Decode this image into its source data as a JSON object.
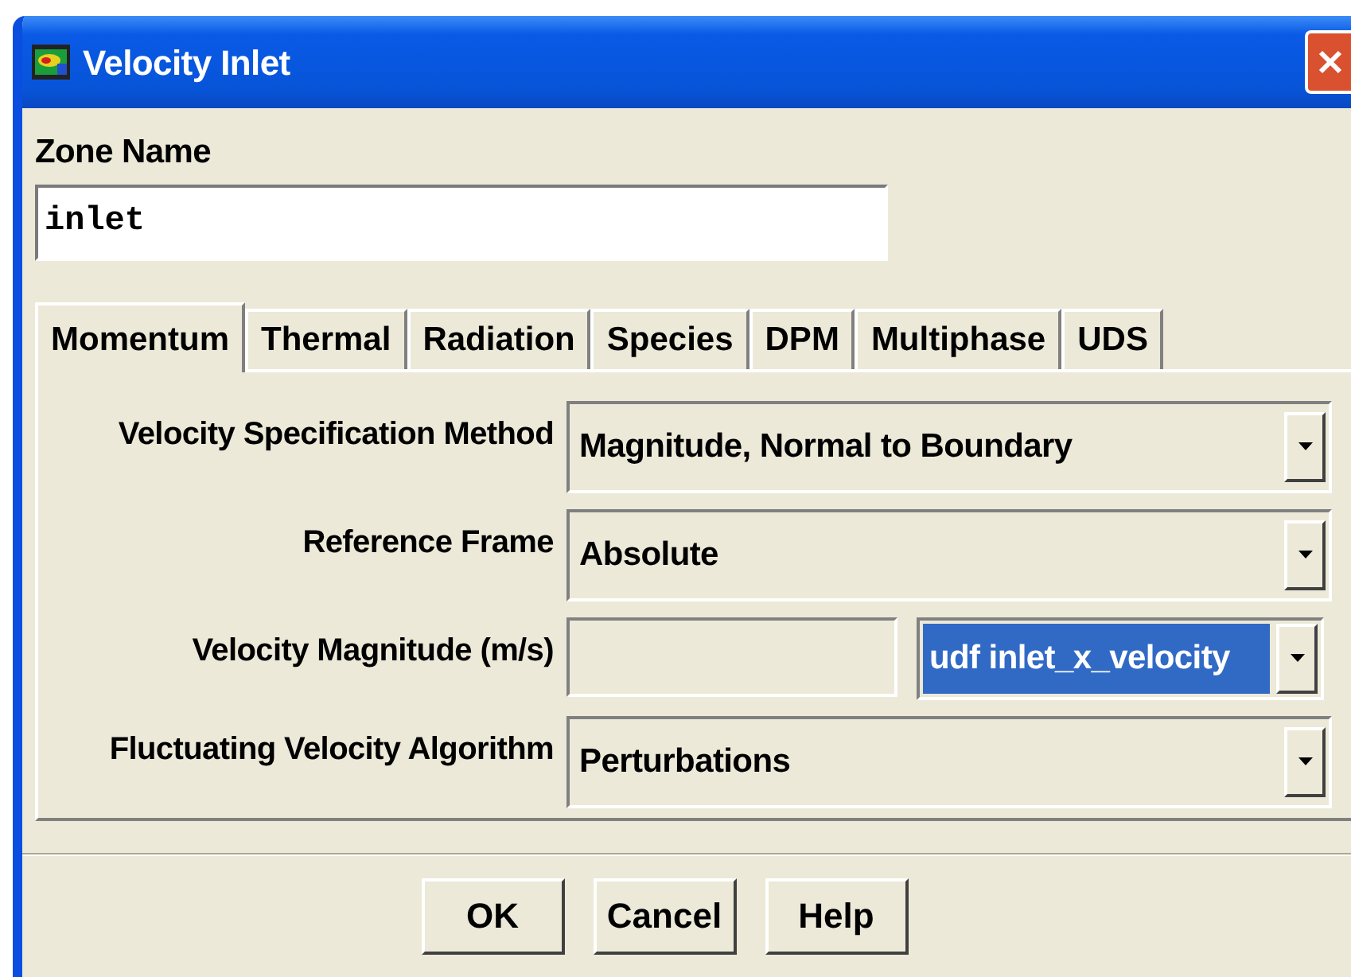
{
  "window": {
    "title": "Velocity Inlet"
  },
  "zone_name": {
    "label": "Zone Name",
    "value": "inlet"
  },
  "tabs": [
    {
      "label": "Momentum",
      "selected": true
    },
    {
      "label": "Thermal",
      "selected": false
    },
    {
      "label": "Radiation",
      "selected": false
    },
    {
      "label": "Species",
      "selected": false
    },
    {
      "label": "DPM",
      "selected": false
    },
    {
      "label": "Multiphase",
      "selected": false
    },
    {
      "label": "UDS",
      "selected": false
    }
  ],
  "fields": [
    {
      "kind": "dropdown",
      "label": "Velocity Specification Method",
      "value": "Magnitude, Normal to Boundary",
      "highlighted": false
    },
    {
      "kind": "dropdown",
      "label": "Reference Frame",
      "value": "Absolute",
      "highlighted": false
    },
    {
      "kind": "input_dropdown",
      "label": "Velocity Magnitude (m/s)",
      "value": "udf inlet_x_velocity",
      "highlighted": true
    },
    {
      "kind": "dropdown",
      "label": "Fluctuating Velocity Algorithm",
      "value": "Perturbations",
      "highlighted": false
    }
  ],
  "buttons": [
    "OK",
    "Cancel",
    "Help"
  ]
}
